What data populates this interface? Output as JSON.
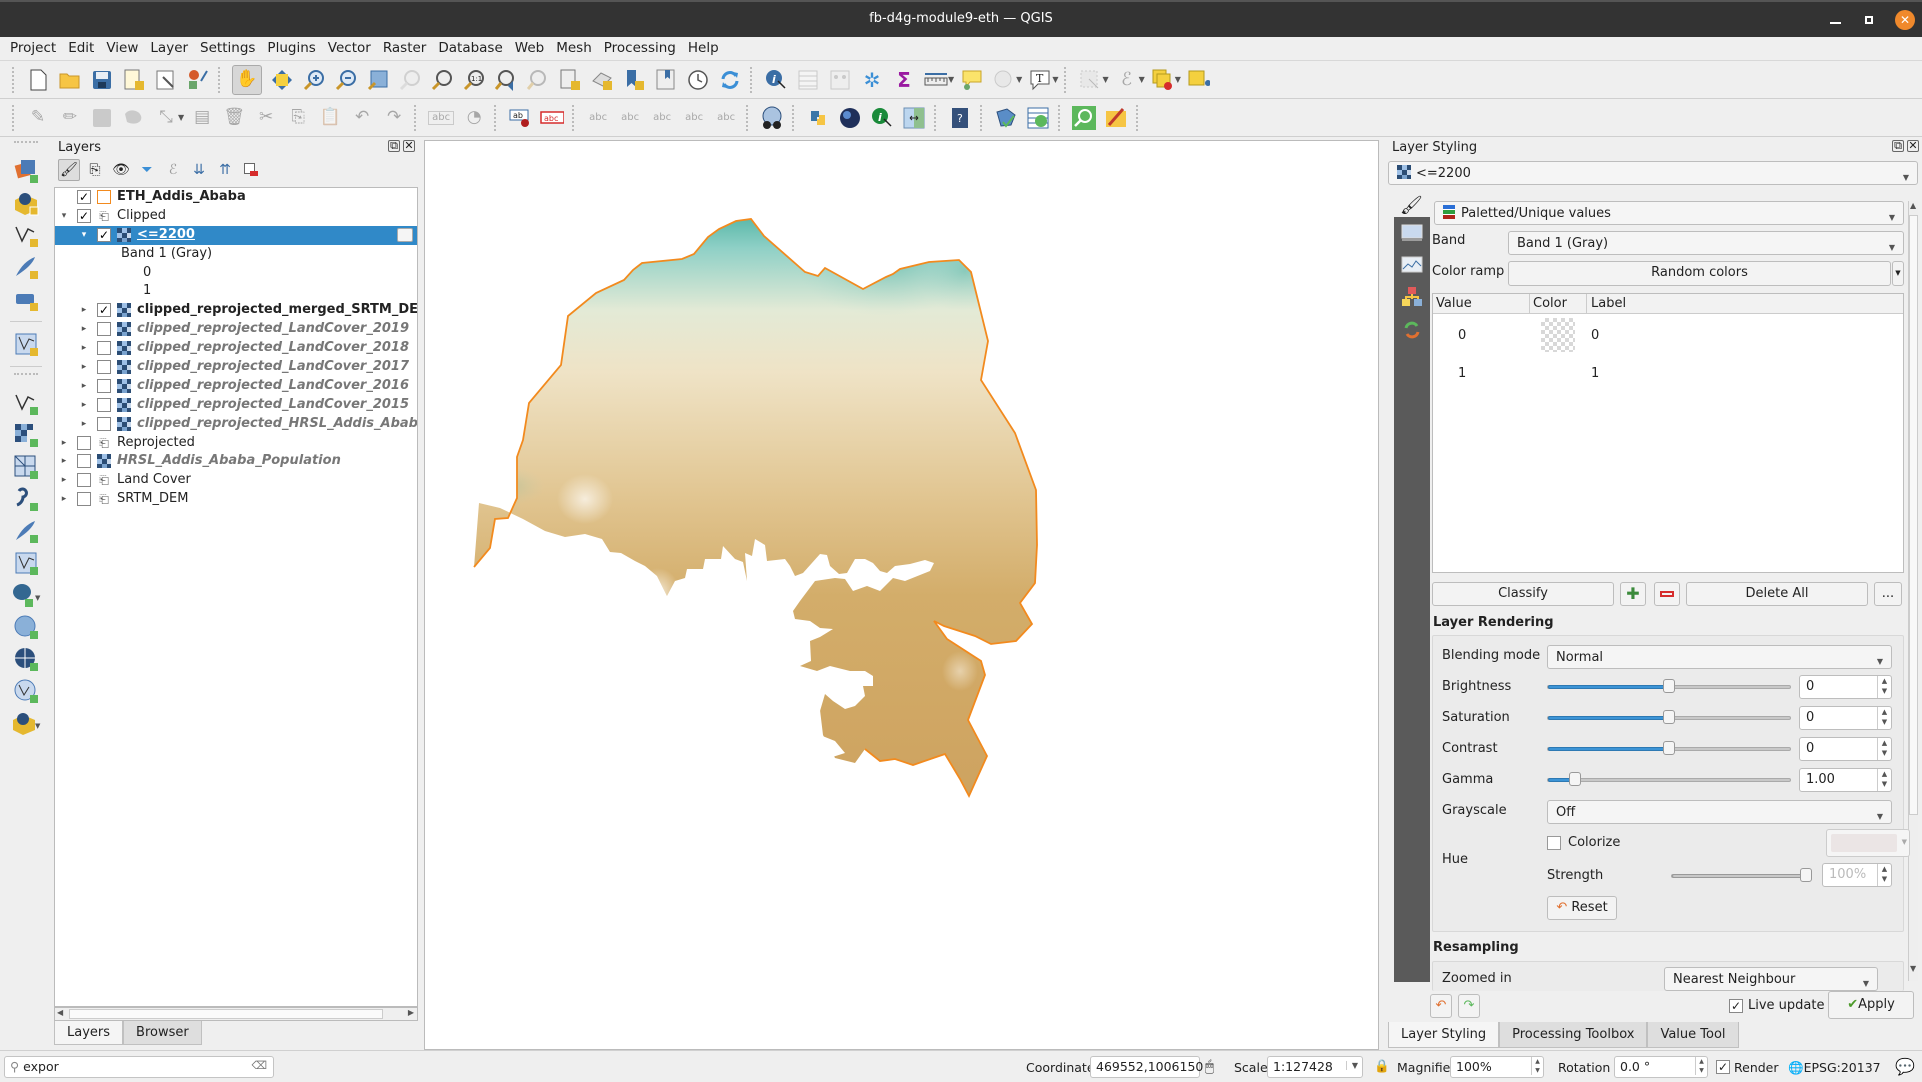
{
  "window": {
    "title": "fb-d4g-module9-eth — QGIS",
    "min_label": "_",
    "max_label": "▫",
    "close_label": "✕"
  },
  "menu": [
    "Project",
    "Edit",
    "View",
    "Layer",
    "Settings",
    "Plugins",
    "Vector",
    "Raster",
    "Database",
    "Web",
    "Mesh",
    "Processing",
    "Help"
  ],
  "layers_panel": {
    "title": "Layers",
    "tree": [
      {
        "label": "ETH_Addis_Ababa",
        "checked": true,
        "style": "bold",
        "type": "vector-polygon",
        "indent": 0,
        "expander": "none"
      },
      {
        "label": "Clipped",
        "checked": true,
        "style": "normal",
        "type": "group",
        "indent": 0,
        "expander": "open"
      },
      {
        "label": "<=2200",
        "checked": true,
        "style": "bold-underline",
        "type": "raster",
        "indent": 1,
        "expander": "open",
        "selected": true
      },
      {
        "label": "Band 1 (Gray)",
        "type": "legend-title",
        "indent": 2
      },
      {
        "label": "0",
        "type": "legend-item",
        "indent": 3
      },
      {
        "label": "1",
        "type": "legend-item",
        "indent": 3
      },
      {
        "label": "clipped_reprojected_merged_SRTM_DEM",
        "checked": true,
        "style": "bold",
        "type": "raster",
        "indent": 1,
        "expander": "closed"
      },
      {
        "label": "clipped_reprojected_LandCover_2019",
        "checked": false,
        "style": "italic",
        "type": "raster",
        "indent": 1,
        "expander": "closed"
      },
      {
        "label": "clipped_reprojected_LandCover_2018",
        "checked": false,
        "style": "italic",
        "type": "raster",
        "indent": 1,
        "expander": "closed"
      },
      {
        "label": "clipped_reprojected_LandCover_2017",
        "checked": false,
        "style": "italic",
        "type": "raster",
        "indent": 1,
        "expander": "closed"
      },
      {
        "label": "clipped_reprojected_LandCover_2016",
        "checked": false,
        "style": "italic",
        "type": "raster",
        "indent": 1,
        "expander": "closed"
      },
      {
        "label": "clipped_reprojected_LandCover_2015",
        "checked": false,
        "style": "italic",
        "type": "raster",
        "indent": 1,
        "expander": "closed"
      },
      {
        "label": "clipped_reprojected_HRSL_Addis_Ababa",
        "checked": false,
        "style": "italic",
        "type": "raster",
        "indent": 1,
        "expander": "closed"
      },
      {
        "label": "Reprojected",
        "checked": false,
        "style": "normal",
        "type": "group",
        "indent": 0,
        "expander": "closed"
      },
      {
        "label": "HRSL_Addis_Ababa_Population",
        "checked": false,
        "style": "italic",
        "type": "raster",
        "indent": 0,
        "expander": "closed"
      },
      {
        "label": "Land Cover",
        "checked": false,
        "style": "normal",
        "type": "group",
        "indent": 0,
        "expander": "closed"
      },
      {
        "label": "SRTM_DEM",
        "checked": false,
        "style": "normal",
        "type": "group",
        "indent": 0,
        "expander": "closed"
      }
    ],
    "tabs": [
      "Layers",
      "Browser"
    ],
    "active_tab": "Layers"
  },
  "locator": {
    "value": "expor",
    "search_icon": "search-icon",
    "clear_icon": "clear-icon"
  },
  "map": {
    "boundary_color": "#f28a1e",
    "ramp_low": "#c9a25c",
    "ramp_mid": "#efe3c6",
    "ramp_high": "#4fb3a3"
  },
  "styling": {
    "title": "Layer Styling",
    "layer": "<=2200",
    "renderer": "Paletted/Unique values",
    "band_label": "Band",
    "band": "Band 1 (Gray)",
    "ramp_label": "Color ramp",
    "ramp": "Random colors",
    "table_headers": [
      "Value",
      "Color",
      "Label"
    ],
    "classes": [
      {
        "value": "0",
        "color": "transparent",
        "label": "0"
      },
      {
        "value": "1",
        "color": "none",
        "label": "1"
      }
    ],
    "classify": "Classify",
    "delete_all": "Delete All",
    "more": "...",
    "rendering_title": "Layer Rendering",
    "blending_label": "Blending mode",
    "blending": "Normal",
    "brightness_label": "Brightness",
    "brightness": "0",
    "brightness_pos": 0.5,
    "saturation_label": "Saturation",
    "saturation": "0",
    "saturation_pos": 0.5,
    "contrast_label": "Contrast",
    "contrast": "0",
    "contrast_pos": 0.5,
    "gamma_label": "Gamma",
    "gamma": "1.00",
    "gamma_pos": 0.11,
    "grayscale_label": "Grayscale",
    "grayscale": "Off",
    "hue_label": "Hue",
    "colorize_label": "Colorize",
    "colorize": false,
    "strength_label": "Strength",
    "strength": "100%",
    "strength_pos": 1.0,
    "reset": "Reset",
    "resampling_title": "Resampling",
    "zoomed_in_label": "Zoomed in",
    "zoomed_in": "Nearest Neighbour",
    "live_update_label": "Live update",
    "live_update": true,
    "apply": "Apply",
    "tabs": [
      "Layer Styling",
      "Processing Toolbox",
      "Value Tool"
    ],
    "active_tab": "Layer Styling"
  },
  "status": {
    "coordinate_label": "Coordinate",
    "coordinate": "469552,1006150",
    "scale_label": "Scale",
    "scale": "1:127428",
    "magnifier_label": "Magnifier",
    "magnifier": "100%",
    "rotation_label": "Rotation",
    "rotation": "0.0 °",
    "render_label": "Render",
    "render": true,
    "crs": "EPSG:20137"
  }
}
